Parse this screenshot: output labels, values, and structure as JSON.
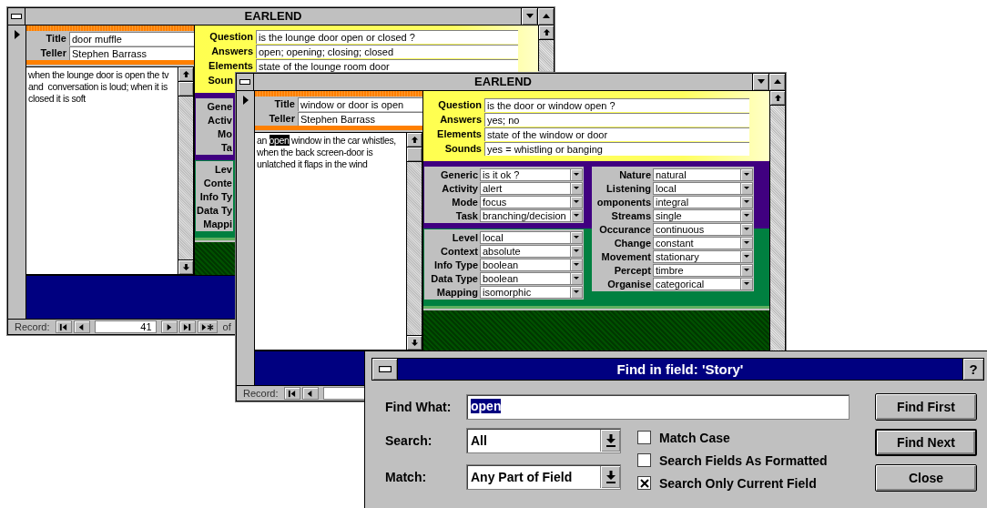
{
  "windows": [
    {
      "title": "EARLEND",
      "header_fields": [
        {
          "label": "Title",
          "value": "door muffle"
        },
        {
          "label": "Teller",
          "value": "Stephen Barrass"
        }
      ],
      "story": [
        {
          "text": "when the lounge door is open the tv and  conversation is loud; when it is closed it is soft",
          "selected": false
        }
      ],
      "question_fields": [
        {
          "label": "Question",
          "value": "is the lounge door open or closed ?"
        },
        {
          "label": "Answers",
          "value": "open; opening; closing; closed"
        },
        {
          "label": "Elements",
          "value": "state of the lounge room door"
        },
        {
          "label": "Soun"
        }
      ],
      "property_columns": [
        {
          "groups": [
            {
              "items": [
                {
                  "label": "Gene"
                },
                {
                  "label": "Activ"
                },
                {
                  "label": "Mo"
                },
                {
                  "label": "Ta"
                }
              ]
            },
            {
              "items": [
                {
                  "label": "Lev"
                },
                {
                  "label": "Conte"
                },
                {
                  "label": "Info Ty"
                },
                {
                  "label": "Data Ty"
                },
                {
                  "label": "Mappi"
                }
              ]
            }
          ]
        }
      ],
      "record_bar": [
        {
          "kind": "label",
          "text": "Record:"
        },
        {
          "kind": "first"
        },
        {
          "kind": "previous"
        },
        {
          "kind": "field",
          "value": "41"
        },
        {
          "kind": "next"
        },
        {
          "kind": "last"
        },
        {
          "kind": "new"
        },
        {
          "kind": "label",
          "text": "of"
        }
      ]
    },
    {
      "title": "EARLEND",
      "header_fields": [
        {
          "label": "Title",
          "value": "window or door is open"
        },
        {
          "label": "Teller",
          "value": "Stephen Barrass"
        }
      ],
      "story": [
        {
          "text": "an ",
          "selected": false
        },
        {
          "text": "open",
          "selected": true
        },
        {
          "text": " window in the car whistles, when the back screen-door is unlatched it flaps in the wind",
          "selected": false
        }
      ],
      "question_fields": [
        {
          "label": "Question",
          "value": "is the door or window open ?"
        },
        {
          "label": "Answers",
          "value": "yes; no"
        },
        {
          "label": "Elements",
          "value": "state of the window or door"
        },
        {
          "label": "Sounds",
          "value": "yes = whistling or banging"
        }
      ],
      "property_columns": [
        {
          "groups": [
            {
              "items": [
                {
                  "label": "Generic",
                  "value": "is it ok ?"
                },
                {
                  "label": "Activity",
                  "value": "alert"
                },
                {
                  "label": "Mode",
                  "value": "focus"
                },
                {
                  "label": "Task",
                  "value": "branching/decision"
                }
              ]
            },
            {
              "items": [
                {
                  "label": "Level",
                  "value": "local"
                },
                {
                  "label": "Context",
                  "value": "absolute"
                },
                {
                  "label": "Info Type",
                  "value": "boolean"
                },
                {
                  "label": "Data Type",
                  "value": "boolean"
                },
                {
                  "label": "Mapping",
                  "value": "isomorphic"
                }
              ]
            }
          ]
        },
        {
          "groups": [
            {
              "items": [
                {
                  "label": "Nature",
                  "value": "natural"
                },
                {
                  "label": "Listening",
                  "value": "local"
                },
                {
                  "label": "omponents",
                  "value": "integral"
                },
                {
                  "label": "Streams",
                  "value": "single"
                },
                {
                  "label": "Occurance",
                  "value": "continuous"
                },
                {
                  "label": "Change",
                  "value": "constant"
                },
                {
                  "label": "Movement",
                  "value": "stationary"
                },
                {
                  "label": "Percept",
                  "value": "timbre"
                },
                {
                  "label": "Organise",
                  "value": "categorical"
                }
              ]
            }
          ]
        }
      ],
      "record_bar": [
        {
          "kind": "label",
          "text": "Record:"
        },
        {
          "kind": "first"
        },
        {
          "kind": "previous"
        },
        {
          "kind": "field"
        }
      ]
    }
  ],
  "dialog": {
    "title": "Find in field: 'Story'",
    "help": "?",
    "find_what": {
      "label": "Find What:",
      "value": "open",
      "selected": true
    },
    "search": {
      "label": "Search:",
      "value": "All"
    },
    "match": {
      "label": "Match:",
      "value": "Any Part of Field"
    },
    "options": [
      {
        "label": "Match Case",
        "checked": false
      },
      {
        "label": "Search Fields As Formatted",
        "checked": false
      },
      {
        "label": "Search Only Current Field",
        "checked": true
      }
    ],
    "buttons": [
      {
        "label": "Find First",
        "default": false
      },
      {
        "label": "Find Next",
        "default": true
      },
      {
        "label": "Close",
        "default": false
      }
    ]
  }
}
